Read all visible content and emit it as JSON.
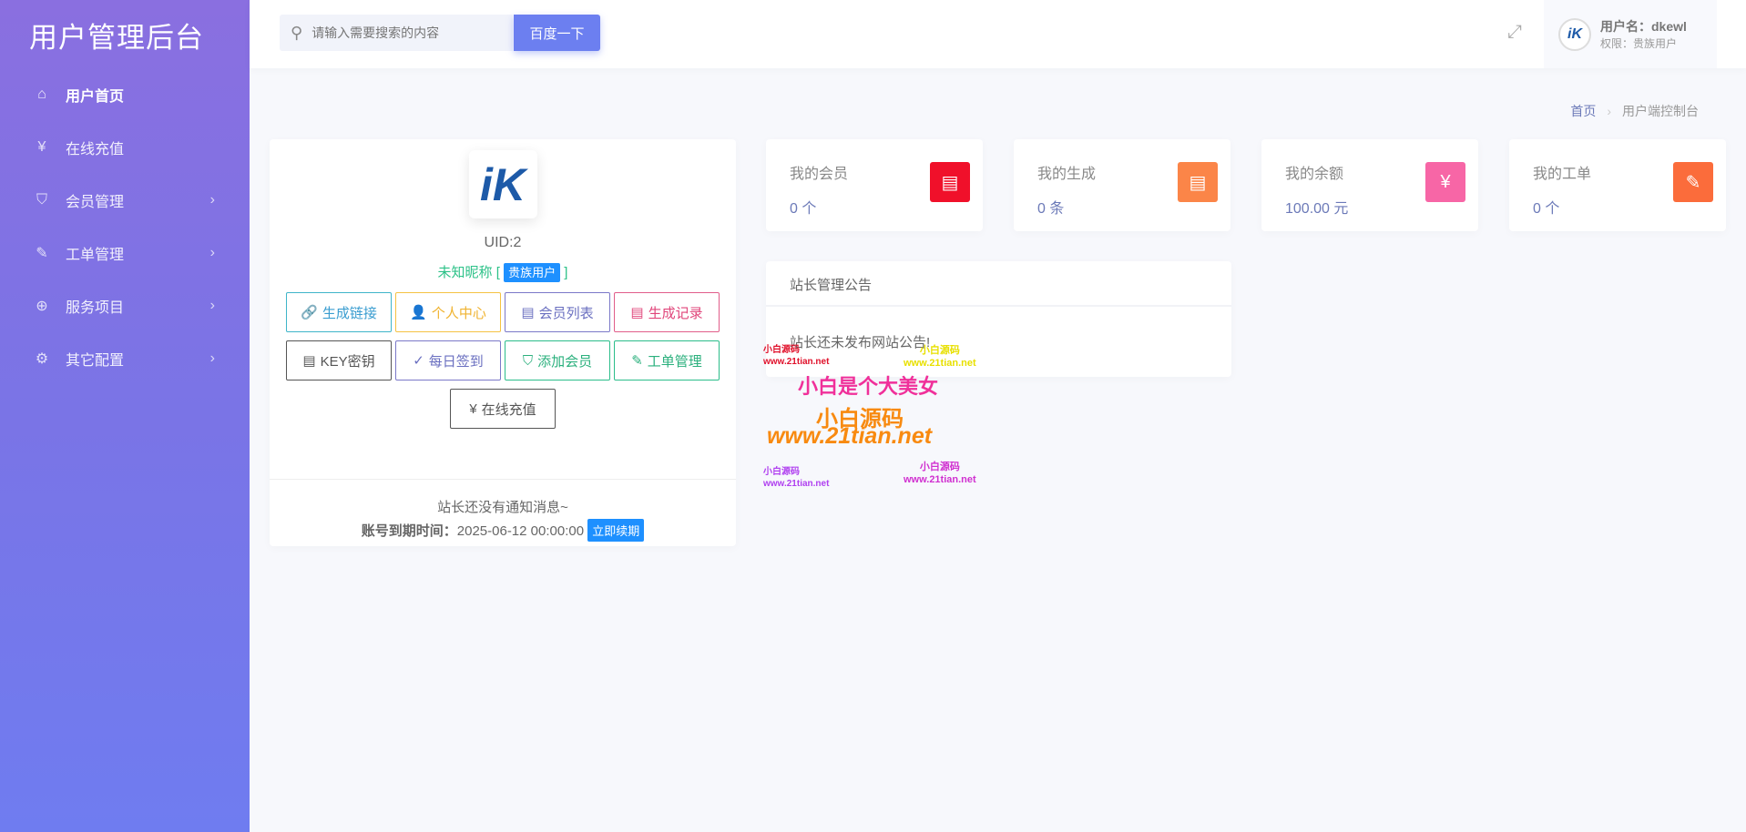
{
  "sidebar": {
    "title": "用户管理后台",
    "items": [
      {
        "label": "用户首页",
        "icon": "home-icon"
      },
      {
        "label": "在线充值",
        "icon": "yen-icon"
      },
      {
        "label": "会员管理",
        "icon": "shield-icon"
      },
      {
        "label": "工单管理",
        "icon": "ticket-icon"
      },
      {
        "label": "服务项目",
        "icon": "globe-icon"
      },
      {
        "label": "其它配置",
        "icon": "gear-icon"
      }
    ]
  },
  "header": {
    "search_placeholder": "请输入需要搜索的内容",
    "search_button": "百度一下",
    "username": "用户名：dkewl",
    "role": "权限：贵族用户"
  },
  "breadcrumb": {
    "home": "首页",
    "sep": "›",
    "current": "用户端控制台"
  },
  "profile": {
    "uid": "UID:2",
    "nickname": "未知昵称",
    "bracket_open": "[",
    "bracket_close": "]",
    "level": "贵族用户",
    "buttons": [
      "生成链接",
      "个人中心",
      "会员列表",
      "生成记录",
      "KEY密钥",
      "每日签到",
      "添加会员",
      "工单管理",
      "在线充值"
    ],
    "notice": "站长还没有通知消息~",
    "expire_label": "账号到期时间：",
    "expire_value": "2025-06-12 00:00:00",
    "renew": "立即续期"
  },
  "stats": [
    {
      "title": "我的会员",
      "value": "0 个",
      "color": "#f0102a"
    },
    {
      "title": "我的生成",
      "value": "0 条",
      "color": "#fb8548"
    },
    {
      "title": "我的余额",
      "value": "100.00 元",
      "color": "#f766a6"
    },
    {
      "title": "我的工单",
      "value": "0 个",
      "color": "#fb6c3b"
    }
  ],
  "announcement": {
    "title": "站长管理公告",
    "body": "站长还未发布网站公告!"
  },
  "watermark": {
    "a": "小白源码",
    "b": "www.21tian.net",
    "c": "小白是个大美女",
    "d": "小白源码",
    "e": "www.21tian.net"
  }
}
